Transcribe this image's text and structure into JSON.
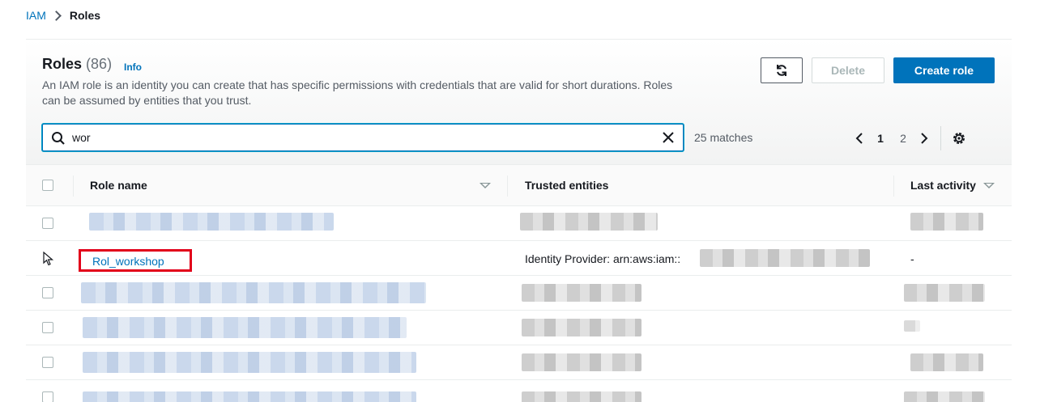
{
  "breadcrumb": {
    "root": "IAM",
    "current": "Roles"
  },
  "header": {
    "title": "Roles",
    "count": "(86)",
    "info": "Info",
    "description": "An IAM role is an identity you can create that has specific permissions with credentials that are valid for short durations. Roles can be assumed by entities that you trust.",
    "delete_label": "Delete",
    "create_label": "Create role"
  },
  "search": {
    "value": "wor",
    "matches": "25 matches"
  },
  "pagination": {
    "pages": [
      "1",
      "2"
    ],
    "current": "1"
  },
  "table": {
    "columns": {
      "role_name": "Role name",
      "trusted_entities": "Trusted entities",
      "last_activity": "Last activity"
    },
    "highlight_row": {
      "role_name": "Rol_workshop",
      "trusted_entity": "Identity Provider: arn:aws:iam::",
      "last_activity": "-"
    }
  },
  "colors": {
    "link": "#0073bb",
    "primary": "#0073bb",
    "highlight_box": "#e2001a"
  },
  "icons": [
    "chevron-right-icon",
    "refresh-icon",
    "search-icon",
    "close-icon",
    "chevron-left-icon",
    "gear-icon",
    "sort-caret-icon",
    "cursor-icon"
  ]
}
